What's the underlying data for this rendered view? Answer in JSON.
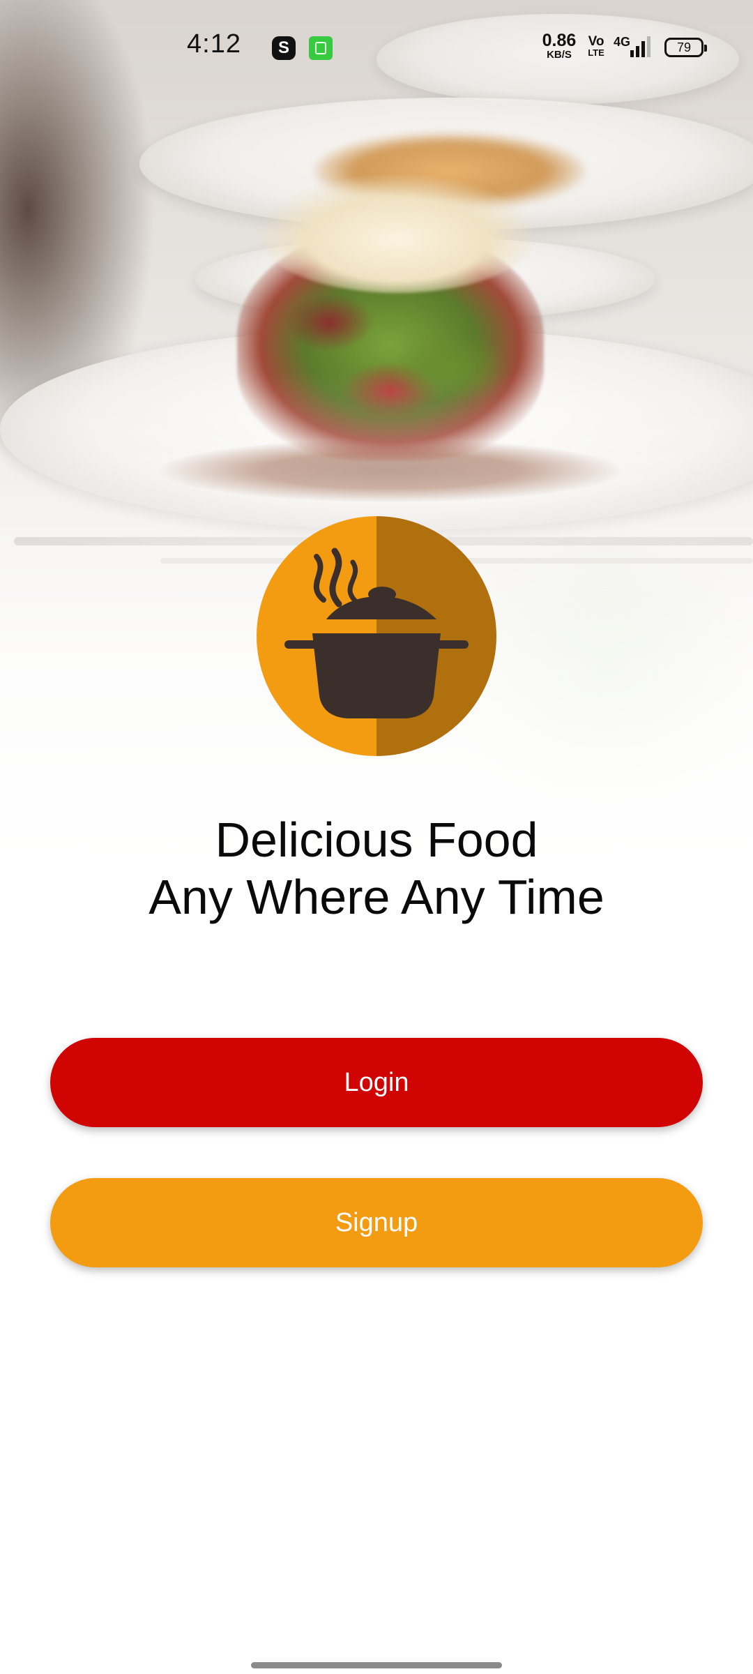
{
  "status_bar": {
    "time": "4:12",
    "app_icon_s": "S",
    "net_speed_value": "0.86",
    "net_speed_unit": "KB/S",
    "volte_top": "Vo",
    "volte_bottom": "LTE",
    "network_type": "4G",
    "battery_level": "79"
  },
  "hero": {
    "image": "food-plate-photo",
    "logo_icon": "cooking-pot-icon"
  },
  "tagline": {
    "line1": "Delicious Food",
    "line2": "Any Where Any Time"
  },
  "actions": {
    "login_label": "Login",
    "signup_label": "Signup"
  },
  "colors": {
    "login": "#d10404",
    "signup": "#f39c12",
    "logo_light": "#f39c12",
    "logo_dark": "#b0700e",
    "pot": "#3a2f2a"
  }
}
